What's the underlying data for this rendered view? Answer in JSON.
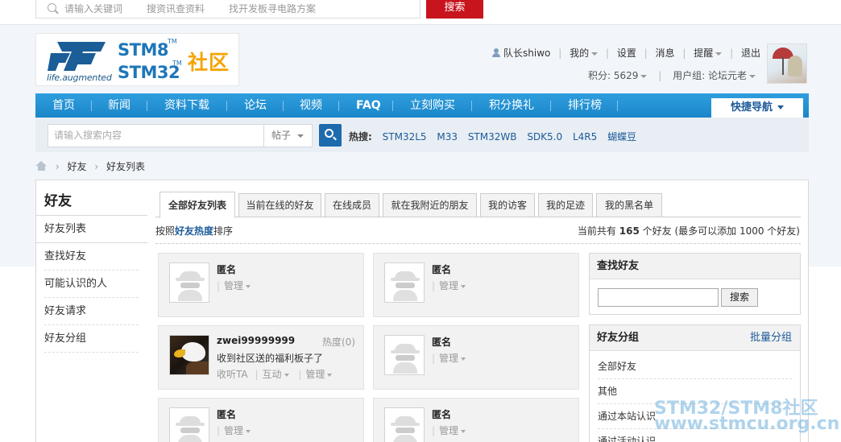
{
  "top_search": {
    "placeholders": [
      "请输入关键词",
      "搜资讯查资料",
      "找开发板寻电路方案"
    ],
    "button": "搜索"
  },
  "logo": {
    "tagline": "life.augmented",
    "stm8": "STM8",
    "stm32": "STM32",
    "tm": "TM",
    "community": "社区"
  },
  "user": {
    "name": "队长shiwo",
    "links": [
      "我的",
      "设置",
      "消息",
      "提醒",
      "退出"
    ],
    "points": "积分: 5629",
    "group": "用户组: 论坛元老"
  },
  "nav": {
    "items": [
      "首页",
      "新闻",
      "资料下载",
      "论坛",
      "视频",
      "FAQ",
      "立刻购买",
      "积分换礼",
      "排行榜"
    ],
    "quick": "快捷导航"
  },
  "search": {
    "placeholder": "请输入搜索内容",
    "scope": "帖子",
    "hot_label": "热搜:",
    "hot_keywords": [
      "STM32L5",
      "M33",
      "STM32WB",
      "SDK5.0",
      "L4R5",
      "蝴蝶豆"
    ]
  },
  "breadcrumb": [
    "好友",
    "好友列表"
  ],
  "sidebar": {
    "title": "好友",
    "items": [
      "好友列表",
      "查找好友",
      "可能认识的人",
      "好友请求",
      "好友分组"
    ]
  },
  "tabs": [
    "全部好友列表",
    "当前在线的好友",
    "在线成员",
    "就在我附近的朋友",
    "我的访客",
    "我的足迹",
    "我的黑名单"
  ],
  "sort": {
    "prefix": "按照",
    "link": "好友热度",
    "suffix": "排序"
  },
  "count": {
    "prefix": "当前共有",
    "number": "165",
    "suffix": "个好友 (最多可以添加 1000 个好友)"
  },
  "friends": [
    {
      "name": "匿名",
      "manage": "管理"
    },
    {
      "name": "匿名",
      "manage": "管理"
    },
    {
      "name": "zwei99999999",
      "heat": "热度(0)",
      "message": "收到社区送的福利板子了",
      "listen": "收听TA",
      "interact": "互动",
      "manage": "管理"
    },
    {
      "name": "匿名",
      "manage": "管理"
    },
    {
      "name": "匿名",
      "manage": "管理"
    },
    {
      "name": "匿名",
      "manage": "管理"
    }
  ],
  "find_panel": {
    "title": "查找好友",
    "button": "搜索"
  },
  "group_panel": {
    "title": "好友分组",
    "action": "批量分组",
    "items": [
      "全部好友",
      "其他",
      "通过本站认识",
      "通过活动认识"
    ]
  },
  "watermark": {
    "line1": "STM32/STM8社区",
    "line2": "www.stmcu.org.cn"
  }
}
